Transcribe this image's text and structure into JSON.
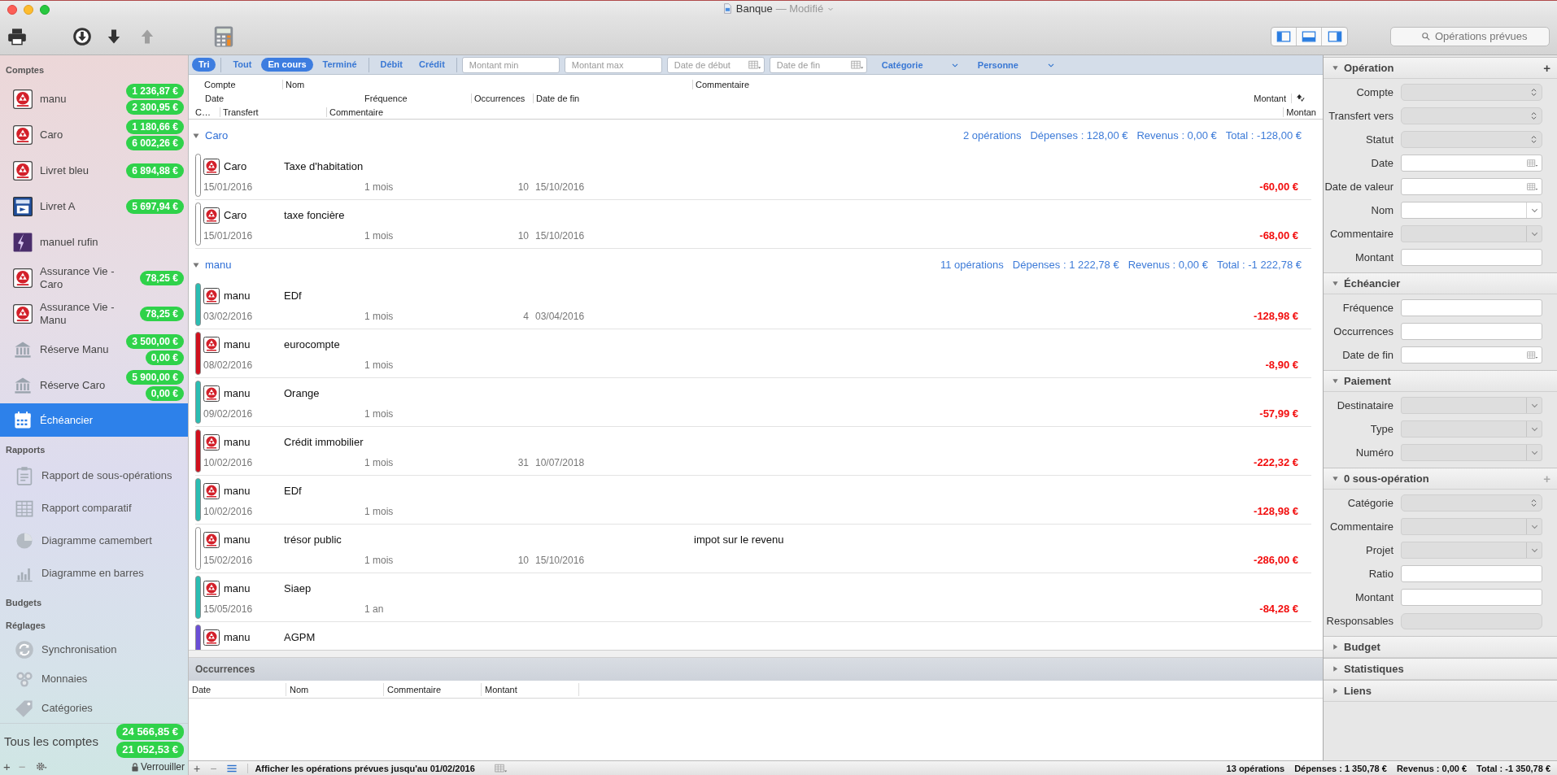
{
  "window": {
    "title": "Banque",
    "status": "— Modifié"
  },
  "toolbar": {
    "buttons": [
      {
        "kind": "print",
        "disabled": false
      },
      {
        "kind": "download",
        "disabled": false
      },
      {
        "kind": "down",
        "disabled": false
      },
      {
        "kind": "up",
        "disabled": true
      },
      {
        "kind": "calculator",
        "disabled": false
      }
    ],
    "view_buttons": [
      {
        "kind": "left"
      },
      {
        "kind": "bottom"
      },
      {
        "kind": "right"
      }
    ],
    "search": {
      "placeholder": "Opérations prévues"
    }
  },
  "sidebar": {
    "sections": [
      {
        "title": "Comptes",
        "items": [
          {
            "kind": "bank",
            "name": "manu",
            "balances": [
              "1 236,87 €",
              "2 300,95 €"
            ],
            "selected": false
          },
          {
            "kind": "bank",
            "name": "Caro",
            "balances": [
              "1 180,66 €",
              "6 002,26 €"
            ],
            "selected": false
          },
          {
            "kind": "bank",
            "name": "Livret bleu",
            "balances": [
              "6 894,88 €"
            ],
            "selected": false
          },
          {
            "kind": "postal",
            "name": "Livret A",
            "balances": [
              "5 697,94 €"
            ],
            "selected": false
          },
          {
            "kind": "lightning",
            "name": "manuel rufin",
            "selected": false
          },
          {
            "kind": "bank",
            "name": "Assurance Vie - Caro",
            "balances": [
              "78,25 €"
            ],
            "selected": false
          },
          {
            "kind": "bank",
            "name": "Assurance Vie - Manu",
            "balances": [
              "78,25 €"
            ],
            "selected": false
          },
          {
            "kind": "building",
            "name": "Réserve Manu",
            "balances": [
              "3 500,00 €",
              "0,00 €"
            ],
            "selected": false
          },
          {
            "kind": "building",
            "name": "Réserve Caro",
            "balances": [
              "5 900,00 €",
              "0,00 €"
            ],
            "selected": false
          },
          {
            "kind": "calendar",
            "name": "Échéancier",
            "selected": true
          }
        ]
      },
      {
        "title": "Rapports",
        "items": [
          {
            "kind": "report",
            "name": "Rapport de sous-opérations",
            "selected": false
          },
          {
            "kind": "compare",
            "name": "Rapport comparatif",
            "selected": false
          },
          {
            "kind": "pie",
            "name": "Diagramme camembert",
            "selected": false
          },
          {
            "kind": "bars",
            "name": "Diagramme en barres",
            "selected": false
          }
        ]
      },
      {
        "title": "Budgets"
      },
      {
        "title": "Réglages",
        "items": [
          {
            "kind": "sync",
            "name": "Synchronisation",
            "selected": false
          },
          {
            "kind": "coins",
            "name": "Monnaies",
            "selected": false
          },
          {
            "kind": "tag",
            "name": "Catégories",
            "selected": false
          }
        ]
      }
    ],
    "total": {
      "label": "Tous les comptes",
      "balances": [
        "24 566,85 €",
        "21 052,53 €"
      ]
    },
    "footer": {
      "buttons": [
        "+",
        "−"
      ],
      "lock_label": "Verrouiller"
    }
  },
  "filter_bar": {
    "sort": {
      "label": "Tri",
      "on": true
    },
    "status_filters": [
      {
        "label": "Tout",
        "selected": false
      },
      {
        "label": "En cours",
        "selected": true
      },
      {
        "label": "Terminé",
        "selected": false
      }
    ],
    "type_filters": [
      {
        "label": "Débit",
        "selected": false
      },
      {
        "label": "Crédit",
        "selected": false
      }
    ],
    "fields": [
      {
        "kind": "text",
        "placeholder": "Montant min"
      },
      {
        "kind": "text",
        "placeholder": "Montant max"
      },
      {
        "kind": "date",
        "placeholder": "Date de début"
      },
      {
        "kind": "date",
        "placeholder": "Date de fin"
      }
    ],
    "menus": [
      "Catégorie",
      "Personne"
    ]
  },
  "columns": {
    "line_1": [
      "Compte",
      "Nom",
      "Commentaire"
    ],
    "line_2": [
      "Date",
      "Fréquence",
      "Occurrences",
      "Date de fin",
      "Montant"
    ],
    "line_3": [
      "C…",
      "Transfert",
      "Commentaire",
      "Montan"
    ]
  },
  "groups": [
    {
      "name": "Caro",
      "expanded": true,
      "count": "2 opérations",
      "expenses": "Dépenses : 128,00 €",
      "income": "Revenus : 0,00 €",
      "total": "Total : -128,00 €",
      "rows": [
        {
          "color": "#ffffff",
          "account": "Caro",
          "name": "Taxe d'habitation",
          "date": "15/01/2016",
          "frequency": "1 mois",
          "occurrences": "10",
          "end_date": "15/10/2016",
          "amount": "-60,00 €"
        },
        {
          "color": "#ffffff",
          "account": "Caro",
          "name": "taxe foncière",
          "date": "15/01/2016",
          "frequency": "1 mois",
          "occurrences": "10",
          "end_date": "15/10/2016",
          "amount": "-68,00 €"
        }
      ]
    },
    {
      "name": "manu",
      "expanded": true,
      "count": "11 opérations",
      "expenses": "Dépenses : 1 222,78 €",
      "income": "Revenus : 0,00 €",
      "total": "Total : -1 222,78 €",
      "rows": [
        {
          "color": "#2bbdb3",
          "account": "manu",
          "name": "EDf",
          "date": "03/02/2016",
          "frequency": "1 mois",
          "occurrences": "4",
          "end_date": "03/04/2016",
          "amount": "-128,98 €"
        },
        {
          "color": "#d0101e",
          "account": "manu",
          "name": "eurocompte",
          "date": "08/02/2016",
          "frequency": "1 mois",
          "amount": "-8,90 €"
        },
        {
          "color": "#2bbdb3",
          "account": "manu",
          "name": "Orange",
          "date": "09/02/2016",
          "frequency": "1 mois",
          "amount": "-57,99 €"
        },
        {
          "color": "#d0101e",
          "account": "manu",
          "name": "Crédit immobilier",
          "date": "10/02/2016",
          "frequency": "1 mois",
          "occurrences": "31",
          "end_date": "10/07/2018",
          "amount": "-222,32 €"
        },
        {
          "color": "#2bbdb3",
          "account": "manu",
          "name": "EDf",
          "date": "10/02/2016",
          "frequency": "1 mois",
          "amount": "-128,98 €"
        },
        {
          "color": "#ffffff",
          "account": "manu",
          "name": "trésor public",
          "comment": "impot sur le revenu",
          "date": "15/02/2016",
          "frequency": "1 mois",
          "occurrences": "10",
          "end_date": "15/10/2016",
          "amount": "-286,00 €"
        },
        {
          "color": "#2bbdb3",
          "account": "manu",
          "name": "Siaep",
          "date": "15/05/2016",
          "frequency": "1 an",
          "amount": "-84,28 €"
        },
        {
          "color": "#6a4ed6",
          "account": "manu",
          "name": "AGPM"
        }
      ]
    }
  ],
  "occurrences": {
    "title": "Occurrences",
    "columns": [
      "Date",
      "Nom",
      "Commentaire",
      "Montant"
    ]
  },
  "inspector": {
    "sections": [
      {
        "title": "Opération",
        "expanded": true,
        "action": "+",
        "action_enabled": true,
        "fields": [
          {
            "label": "Compte",
            "kind": "popup",
            "disabled": true
          },
          {
            "label": "Transfert vers",
            "kind": "popup",
            "disabled": true
          },
          {
            "label": "Statut",
            "kind": "popup",
            "disabled": true
          },
          {
            "label": "Date",
            "kind": "date",
            "disabled": false
          },
          {
            "label": "Date de valeur",
            "kind": "date",
            "disabled": false
          },
          {
            "label": "Nom",
            "kind": "combo",
            "disabled": false
          },
          {
            "label": "Commentaire",
            "kind": "combo",
            "disabled": true
          },
          {
            "label": "Montant",
            "kind": "text",
            "disabled": false
          }
        ]
      },
      {
        "title": "Échéancier",
        "expanded": true,
        "fields": [
          {
            "label": "Fréquence",
            "kind": "text",
            "disabled": false
          },
          {
            "label": "Occurrences",
            "kind": "text",
            "disabled": false
          },
          {
            "label": "Date de fin",
            "kind": "date",
            "disabled": false
          }
        ]
      },
      {
        "title": "Paiement",
        "expanded": true,
        "fields": [
          {
            "label": "Destinataire",
            "kind": "combo",
            "disabled": true
          },
          {
            "label": "Type",
            "kind": "combo",
            "disabled": true
          },
          {
            "label": "Numéro",
            "kind": "combo",
            "disabled": true
          }
        ]
      },
      {
        "title": "0 sous-opération",
        "expanded": true,
        "action": "+",
        "action_enabled": false,
        "fields": [
          {
            "label": "Catégorie",
            "kind": "popup",
            "disabled": true
          },
          {
            "label": "Commentaire",
            "kind": "combo",
            "disabled": true
          },
          {
            "label": "Projet",
            "kind": "combo",
            "disabled": true
          },
          {
            "label": "Ratio",
            "kind": "text",
            "disabled": false
          },
          {
            "label": "Montant",
            "kind": "text",
            "disabled": false
          },
          {
            "label": "Responsables",
            "kind": "token",
            "disabled": true
          }
        ]
      },
      {
        "title": "Budget",
        "expanded": false
      },
      {
        "title": "Statistiques",
        "expanded": false
      },
      {
        "title": "Liens",
        "expanded": false
      }
    ]
  },
  "status_bar": {
    "buttons": [
      "+",
      "−"
    ],
    "forecast_label": "Afficher les opérations prévues jusqu'au 01/02/2016",
    "count": "13 opérations",
    "expenses": "Dépenses : 1 350,78 €",
    "income": "Revenus : 0,00 €",
    "total": "Total : -1 350,78 €"
  }
}
